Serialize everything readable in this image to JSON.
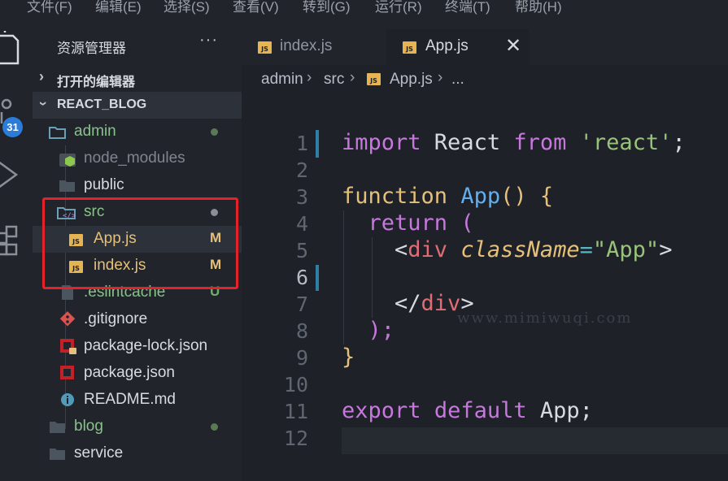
{
  "menu": [
    "文件(F)",
    "编辑(E)",
    "选择(S)",
    "查看(V)",
    "转到(G)",
    "运行(R)",
    "终端(T)",
    "帮助(H)"
  ],
  "activity": {
    "source_control_badge": "31"
  },
  "sidebar": {
    "title": "资源管理器",
    "more": "···",
    "open_editors": "打开的编辑器",
    "workspace": "REACT_BLOG",
    "tree": [
      {
        "name": "admin",
        "status": "",
        "dot_color": "#5a7a55"
      },
      {
        "name": "node_modules",
        "status": ""
      },
      {
        "name": "public",
        "status": ""
      },
      {
        "name": "src",
        "status": "",
        "dot_color": "#8a8e96"
      },
      {
        "name": "App.js",
        "status": "M"
      },
      {
        "name": "index.js",
        "status": "M"
      },
      {
        "name": ".eslintcache",
        "status": "U"
      },
      {
        "name": ".gitignore",
        "status": ""
      },
      {
        "name": "package-lock.json",
        "status": ""
      },
      {
        "name": "package.json",
        "status": ""
      },
      {
        "name": "README.md",
        "status": ""
      },
      {
        "name": "blog",
        "status": "",
        "dot_color": "#5a7a55"
      },
      {
        "name": "service",
        "status": ""
      }
    ]
  },
  "tabs": [
    {
      "label": "index.js",
      "active": false
    },
    {
      "label": "App.js",
      "active": true,
      "close": "✕"
    }
  ],
  "breadcrumb": [
    "admin",
    "src",
    "App.js",
    "..."
  ],
  "editor": {
    "line_numbers": [
      "1",
      "2",
      "3",
      "4",
      "5",
      "6",
      "7",
      "8",
      "9",
      "10",
      "11",
      "12"
    ],
    "watermark": "www.mimiwuqi.com",
    "lines": [
      [
        [
          "import",
          "#c678dd"
        ],
        [
          " React ",
          "#d7dae0"
        ],
        [
          "from",
          "#c678dd"
        ],
        [
          " ",
          "#d7dae0"
        ],
        [
          "'react'",
          "#98c379"
        ],
        [
          ";",
          "#d7dae0"
        ]
      ],
      [],
      [
        [
          "function",
          "#e5c07b"
        ],
        [
          " ",
          "#d7dae0"
        ],
        [
          "App",
          "#61afef"
        ],
        [
          "()",
          "#e5c07b"
        ],
        [
          " {",
          "#e5c07b"
        ]
      ],
      [
        [
          "  ",
          "#d7dae0"
        ],
        [
          "return",
          "#c678dd"
        ],
        [
          " (",
          "#c678dd"
        ]
      ],
      [
        [
          "    <",
          "#d7dae0"
        ],
        [
          "div",
          "#e06c75"
        ],
        [
          " ",
          "#d7dae0"
        ],
        [
          "className",
          "#e5c07b"
        ],
        [
          "=",
          "#56b6c2"
        ],
        [
          "\"App\"",
          "#98c379"
        ],
        [
          ">",
          "#d7dae0"
        ]
      ],
      [],
      [
        [
          "    </",
          "#d7dae0"
        ],
        [
          "div",
          "#e06c75"
        ],
        [
          ">",
          "#d7dae0"
        ]
      ],
      [
        [
          "  );",
          "#c678dd"
        ]
      ],
      [
        [
          "}",
          "#e5c07b"
        ]
      ],
      [],
      [
        [
          "export",
          "#c678dd"
        ],
        [
          " ",
          "#d7dae0"
        ],
        [
          "default",
          "#c678dd"
        ],
        [
          " App;",
          "#d7dae0"
        ]
      ],
      []
    ]
  }
}
